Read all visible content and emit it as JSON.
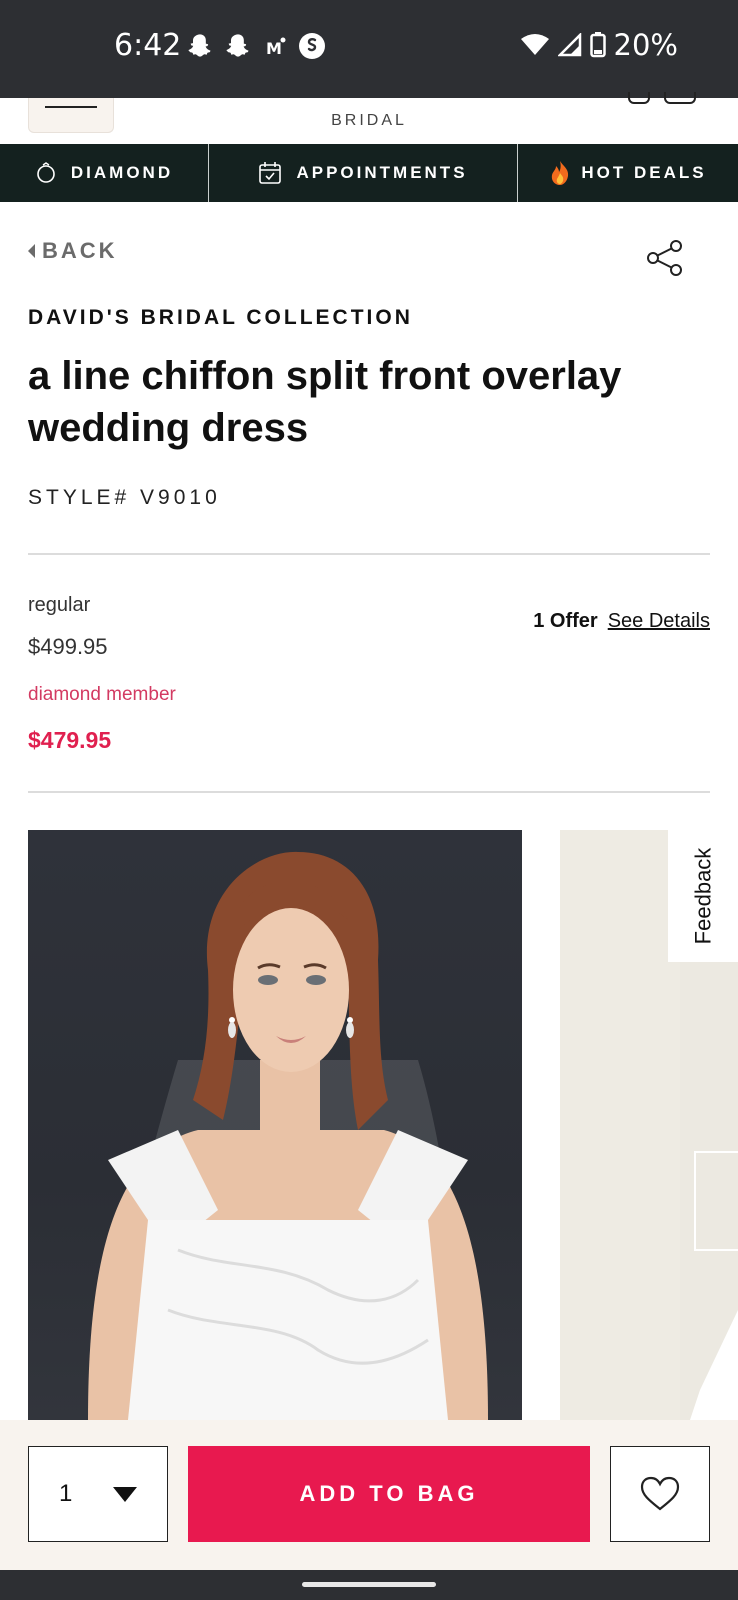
{
  "status_bar": {
    "time": "6:42",
    "left_icons": [
      "snapchat-icon",
      "snapchat-icon",
      "gmail-icon",
      "shazam-icon"
    ],
    "battery": "20%"
  },
  "header": {
    "brand": "BRIDAL"
  },
  "promo_nav": {
    "items": [
      {
        "label": "DIAMOND",
        "icon": "ring-icon"
      },
      {
        "label": "APPOINTMENTS",
        "icon": "calendar-icon"
      },
      {
        "label": "HOT DEALS",
        "icon": "fire-icon"
      }
    ]
  },
  "product": {
    "back": "BACK",
    "collection": "DAVID'S BRIDAL COLLECTION",
    "title": "a line chiffon split front overlay wedding dress",
    "style": "STYLE# V9010",
    "regular_label": "regular",
    "regular_price": "$499.95",
    "member_label": "diamond member",
    "member_price": "$479.95",
    "offer_count": "1 Offer",
    "offer_link": "See Details"
  },
  "feedback": "Feedback",
  "purchase": {
    "quantity": "1",
    "add_to_bag": "ADD TO BAG"
  },
  "colors": {
    "accent": "#e8194f",
    "nav_bg": "#14211f",
    "member": "#d33a62"
  }
}
